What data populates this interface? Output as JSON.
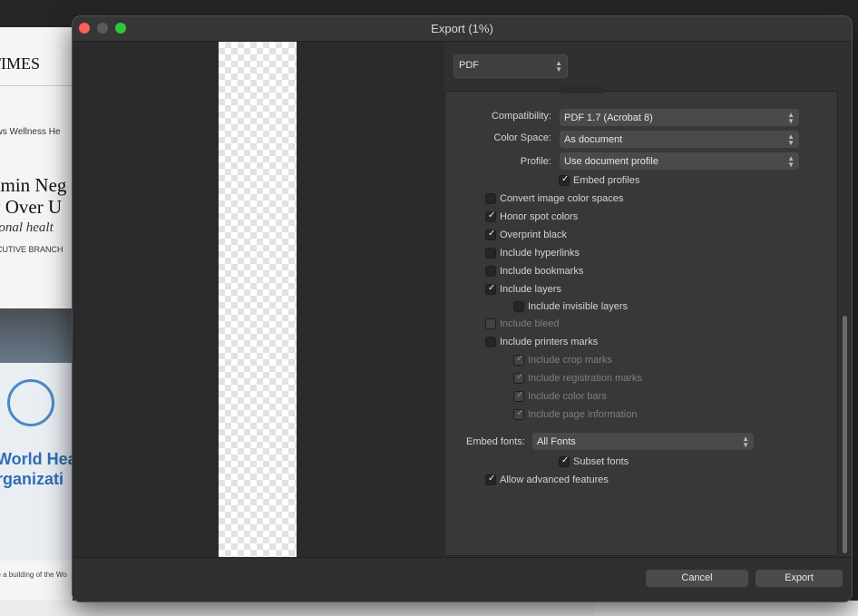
{
  "background": {
    "masthead": "TIMES",
    "nav": "ews   Wellness   He",
    "headline_line1": "dmin  Neg",
    "headline_line2": "y  Over U",
    "subhead": "tional  healt",
    "kicker": "ECUTIVE BRANCH",
    "sign_line1": "World Hea",
    "sign_line2": "rganizati",
    "caption": "de a building of the Wo"
  },
  "window": {
    "title": "Export (1%)"
  },
  "format": {
    "selected": "PDF"
  },
  "settings": {
    "compatibility_label": "Compatibility:",
    "compatibility_value": "PDF 1.7 (Acrobat 8)",
    "color_space_label": "Color Space:",
    "color_space_value": "As document",
    "profile_label": "Profile:",
    "profile_value": "Use document profile",
    "embed_profiles": "Embed profiles",
    "convert_image": "Convert image color spaces",
    "honor_spot": "Honor spot colors",
    "overprint_black": "Overprint black",
    "include_hyperlinks": "Include hyperlinks",
    "include_bookmarks": "Include bookmarks",
    "include_layers": "Include layers",
    "include_invisible_layers": "Include invisible layers",
    "include_bleed": "Include bleed",
    "include_printers_marks": "Include printers marks",
    "include_crop_marks": "Include crop marks",
    "include_registration_marks": "Include registration marks",
    "include_color_bars": "Include color bars",
    "include_page_information": "Include page information",
    "embed_fonts_label": "Embed  fonts:",
    "embed_fonts_value": "All Fonts",
    "subset_fonts": "Subset fonts",
    "allow_advanced": "Allow advanced features"
  },
  "buttons": {
    "cancel": "Cancel",
    "export": "Export"
  }
}
